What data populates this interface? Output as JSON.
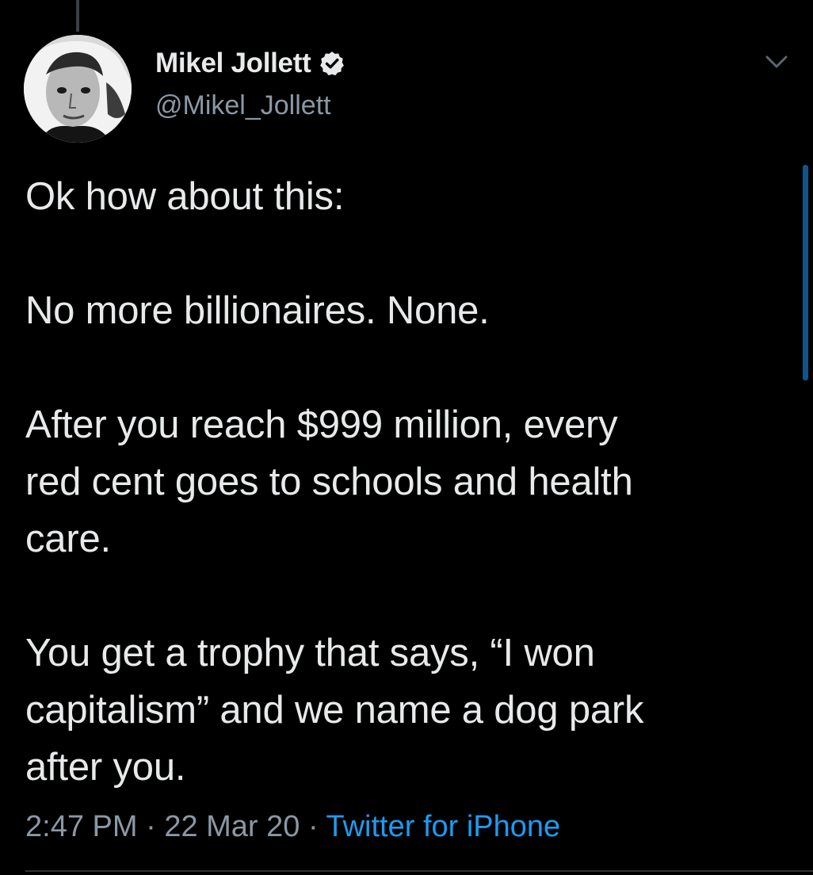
{
  "tweet": {
    "author": {
      "name": "Mikel Jollett",
      "handle": "@Mikel_Jollett",
      "verified": true,
      "verified_icon": "verified-badge-icon"
    },
    "menu_icon": "chevron-down-icon",
    "paragraphs": [
      {
        "lines": [
          "Ok how about this:"
        ]
      },
      {
        "lines": [
          "No more billionaires. None."
        ]
      },
      {
        "lines": [
          "After you reach $999 million, every",
          "red cent goes to schools and health",
          "care."
        ]
      },
      {
        "lines": [
          "You get a trophy that says, “I won",
          "capitalism” and we name a dog park",
          "after you."
        ]
      }
    ],
    "time": "2:47 PM",
    "date": "22 Mar 20",
    "separator": "·",
    "source": "Twitter for iPhone"
  },
  "colors": {
    "background": "#000000",
    "text_primary": "#e7e9ea",
    "text_secondary": "#8b98a5",
    "accent": "#1d9bf0"
  }
}
